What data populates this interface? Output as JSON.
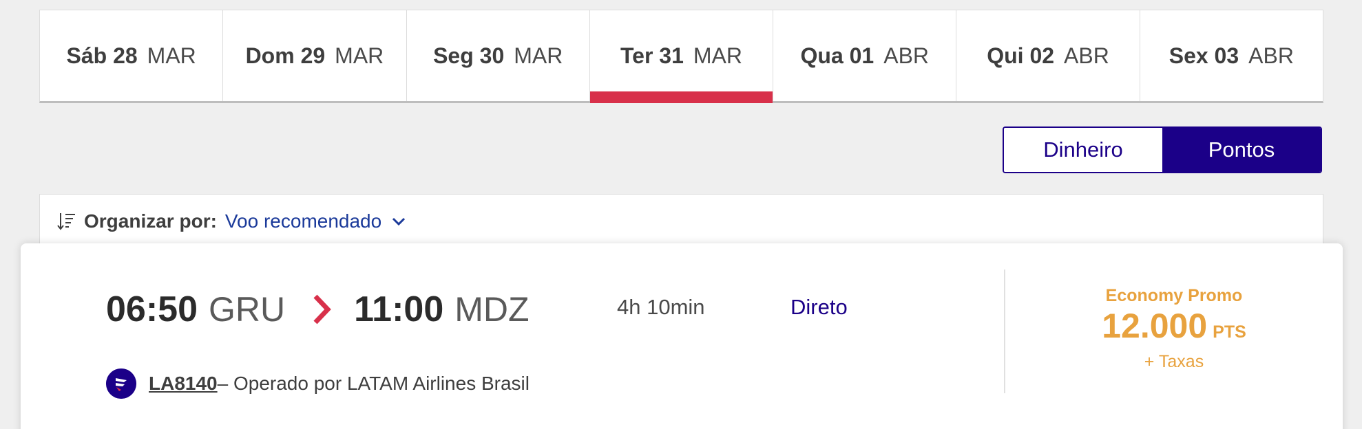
{
  "dates": [
    {
      "day": "Sáb 28",
      "month": "MAR",
      "active": false
    },
    {
      "day": "Dom 29",
      "month": "MAR",
      "active": false
    },
    {
      "day": "Seg 30",
      "month": "MAR",
      "active": false
    },
    {
      "day": "Ter 31",
      "month": "MAR",
      "active": true
    },
    {
      "day": "Qua 01",
      "month": "ABR",
      "active": false
    },
    {
      "day": "Qui 02",
      "month": "ABR",
      "active": false
    },
    {
      "day": "Sex 03",
      "month": "ABR",
      "active": false
    }
  ],
  "currency": {
    "money_label": "Dinheiro",
    "points_label": "Pontos",
    "selected": "Pontos"
  },
  "sort": {
    "label": "Organizar por:",
    "value": "Voo recomendado"
  },
  "flight": {
    "departure_time": "06:50",
    "departure_airport": "GRU",
    "arrival_time": "11:00",
    "arrival_airport": "MDZ",
    "duration": "4h 10min",
    "stops": "Direto",
    "fare_class": "Economy Promo",
    "price": "12.000",
    "price_unit": "PTS",
    "taxes": "+ Taxas",
    "flight_number": "LA8140",
    "operated_by": " – Operado por LATAM Airlines Brasil"
  },
  "colors": {
    "accent": "#d8304a",
    "brand": "#1b0088",
    "fare": "#e8a23e",
    "link": "#1b3a9a"
  },
  "icons": {
    "sort": "sort-lines-icon",
    "chevron": "chevron-down-icon",
    "arrow": "chevron-right-icon",
    "airline": "latam-logo-icon"
  }
}
